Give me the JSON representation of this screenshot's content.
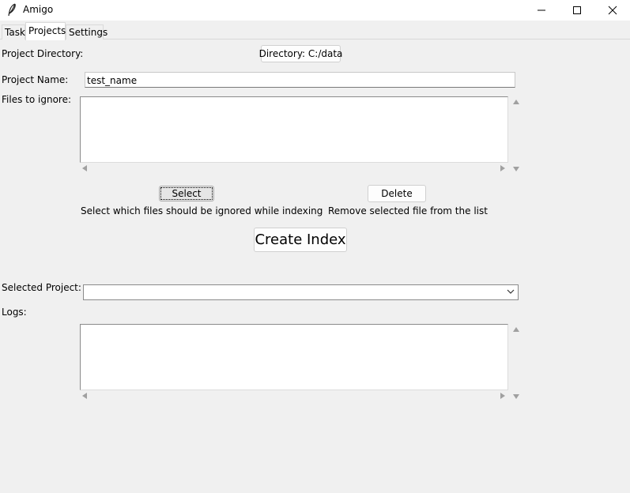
{
  "window": {
    "title": "Amigo"
  },
  "tabs": [
    {
      "label": "Task"
    },
    {
      "label": "Projects",
      "selected": true
    },
    {
      "label": "Settings"
    }
  ],
  "projects": {
    "directory_label": "Project Directory:",
    "directory_button": "Directory: C:/data",
    "name_label": "Project Name:",
    "name_value": "test_name",
    "ignore_label": "Files to ignore:",
    "select_button": "Select",
    "select_hint": "Select which files should be ignored while indexing",
    "delete_button": "Delete",
    "delete_hint": "Remove selected file from the list",
    "create_index_button": "Create Index",
    "selected_project_label": "Selected Project:",
    "selected_project_value": "",
    "logs_label": "Logs:"
  },
  "icons": {
    "app": "feather-icon",
    "minimize": "minimize-icon",
    "maximize": "maximize-icon",
    "close": "close-icon"
  }
}
